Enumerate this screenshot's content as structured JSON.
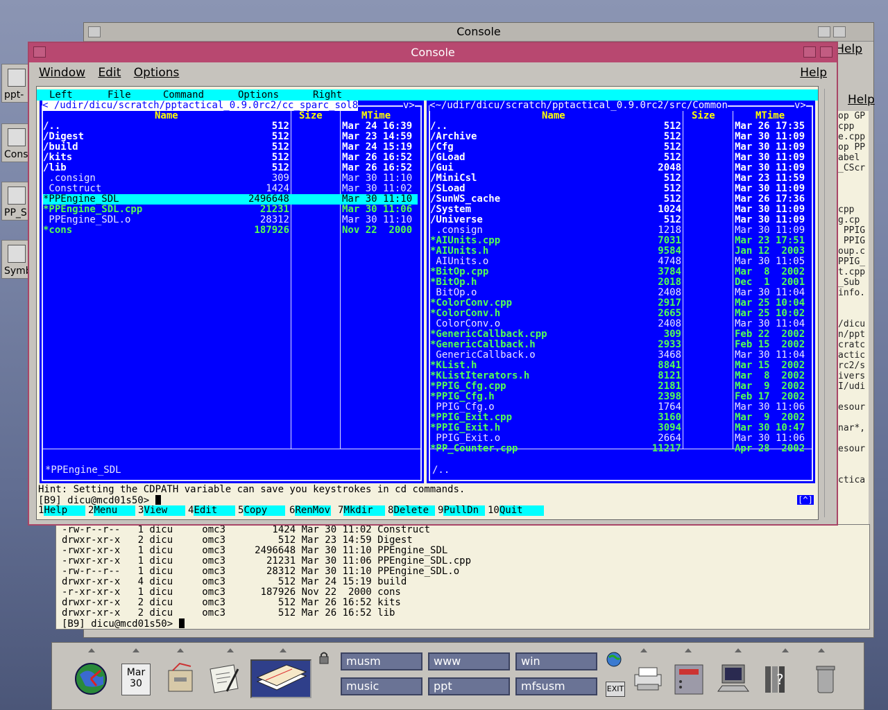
{
  "back_window": {
    "title": "Console",
    "help": "Help",
    "help2": "Help"
  },
  "left_icons": [
    "ppt-",
    "Cons",
    "PP_S",
    "Symb"
  ],
  "right_strip_lines": [
    "op GP",
    "cpp",
    "e.cpp",
    "op PP",
    "abel",
    "_CScr",
    "",
    "",
    "",
    "cpp",
    "g.cp",
    " PPIG",
    " PPIG",
    "oup.c",
    "PPIG_",
    "t.cpp",
    "_Sub",
    "info.",
    "",
    "",
    "/dicu",
    "n/ppt",
    "cratc",
    "actic",
    "rc2/s",
    "ivers",
    "I/udi",
    "",
    "esour",
    "",
    "nar*,",
    "",
    "esour",
    "",
    "",
    "ctica"
  ],
  "bottom_terminal_lines": [
    "-rw-r--r--   1 dicu     omc3        1424 Mar 30 11:02 Construct",
    "drwxr-xr-x   2 dicu     omc3         512 Mar 23 14:59 Digest",
    "-rwxr-xr-x   1 dicu     omc3     2496648 Mar 30 11:10 PPEngine_SDL",
    "-rwxr-xr-x   1 dicu     omc3       21231 Mar 30 11:06 PPEngine_SDL.cpp",
    "-rw-r--r--   1 dicu     omc3       28312 Mar 30 11:10 PPEngine_SDL.o",
    "drwxr-xr-x   4 dicu     omc3         512 Mar 24 15:19 build",
    "-r-xr-xr-x   1 dicu     omc3      187926 Nov 22  2000 cons",
    "drwxr-xr-x   2 dicu     omc3         512 Mar 26 16:52 kits",
    "drwxr-xr-x   2 dicu     omc3         512 Mar 26 16:52 lib"
  ],
  "bottom_prompt": "[B9] dicu@mcd01s50> ",
  "main_window": {
    "title": "Console",
    "menu": {
      "window": "Window",
      "edit": "Edit",
      "options": "Options",
      "help": "Help"
    }
  },
  "mc": {
    "menubar": [
      "Left",
      "File",
      "Command",
      "Options",
      "Right"
    ],
    "left_panel": {
      "path": "/udir/dicu/scratch/pptactical_0.9.0rc2/cc_sparc_sol8",
      "path_prefix": "<",
      "path_suffix": "v>",
      "headers": {
        "name": "Name",
        "size": "Size",
        "mtime": "MTime"
      },
      "rows": [
        {
          "name": "/..",
          "size": "512",
          "mtime": "Mar 24 16:39",
          "kind": "dir"
        },
        {
          "name": "/Digest",
          "size": "512",
          "mtime": "Mar 23 14:59",
          "kind": "dir"
        },
        {
          "name": "/build",
          "size": "512",
          "mtime": "Mar 24 15:19",
          "kind": "dir"
        },
        {
          "name": "/kits",
          "size": "512",
          "mtime": "Mar 26 16:52",
          "kind": "dir"
        },
        {
          "name": "/lib",
          "size": "512",
          "mtime": "Mar 26 16:52",
          "kind": "dir"
        },
        {
          "name": " .consign",
          "size": "309",
          "mtime": "Mar 30 11:10",
          "kind": "plain"
        },
        {
          "name": " Construct",
          "size": "1424",
          "mtime": "Mar 30 11:02",
          "kind": "plain"
        },
        {
          "name": "*PPEngine_SDL",
          "size": "2496648",
          "mtime": "Mar 30 11:10",
          "kind": "sel"
        },
        {
          "name": "*PPEngine_SDL.cpp",
          "size": "21231",
          "mtime": "Mar 30 11:06",
          "kind": "exec"
        },
        {
          "name": " PPEngine_SDL.o",
          "size": "28312",
          "mtime": "Mar 30 11:10",
          "kind": "plain"
        },
        {
          "name": "*cons",
          "size": "187926",
          "mtime": "Nov 22  2000",
          "kind": "exec"
        }
      ],
      "status": "*PPEngine_SDL"
    },
    "right_panel": {
      "path": "~/udir/dicu/scratch/pptactical_0.9.0rc2/src/Common",
      "path_prefix": "<",
      "path_suffix": "v>",
      "headers": {
        "name": "Name",
        "size": "Size",
        "mtime": "MTime"
      },
      "rows": [
        {
          "name": "/..",
          "size": "512",
          "mtime": "Mar 26 17:35",
          "kind": "dir"
        },
        {
          "name": "/Archive",
          "size": "512",
          "mtime": "Mar 30 11:09",
          "kind": "dir"
        },
        {
          "name": "/Cfg",
          "size": "512",
          "mtime": "Mar 30 11:09",
          "kind": "dir"
        },
        {
          "name": "/GLoad",
          "size": "512",
          "mtime": "Mar 30 11:09",
          "kind": "dir"
        },
        {
          "name": "/Gui",
          "size": "2048",
          "mtime": "Mar 30 11:09",
          "kind": "dir"
        },
        {
          "name": "/MiniCsl",
          "size": "512",
          "mtime": "Mar 23 11:59",
          "kind": "dir"
        },
        {
          "name": "/SLoad",
          "size": "512",
          "mtime": "Mar 30 11:09",
          "kind": "dir"
        },
        {
          "name": "/SunWS_cache",
          "size": "512",
          "mtime": "Mar 26 17:36",
          "kind": "dir"
        },
        {
          "name": "/System",
          "size": "1024",
          "mtime": "Mar 30 11:09",
          "kind": "dir"
        },
        {
          "name": "/Universe",
          "size": "512",
          "mtime": "Mar 30 11:09",
          "kind": "dir"
        },
        {
          "name": " .consign",
          "size": "1218",
          "mtime": "Mar 30 11:09",
          "kind": "plain"
        },
        {
          "name": "*AIUnits.cpp",
          "size": "7031",
          "mtime": "Mar 23 17:51",
          "kind": "exec"
        },
        {
          "name": "*AIUnits.h",
          "size": "9584",
          "mtime": "Jan 12  2003",
          "kind": "exec"
        },
        {
          "name": " AIUnits.o",
          "size": "4748",
          "mtime": "Mar 30 11:05",
          "kind": "plain"
        },
        {
          "name": "*BitOp.cpp",
          "size": "3784",
          "mtime": "Mar  8  2002",
          "kind": "exec"
        },
        {
          "name": "*BitOp.h",
          "size": "2018",
          "mtime": "Dec  1  2001",
          "kind": "exec"
        },
        {
          "name": " BitOp.o",
          "size": "2408",
          "mtime": "Mar 30 11:04",
          "kind": "plain"
        },
        {
          "name": "*ColorConv.cpp",
          "size": "2917",
          "mtime": "Mar 25 10:04",
          "kind": "exec"
        },
        {
          "name": "*ColorConv.h",
          "size": "2665",
          "mtime": "Mar 25 10:02",
          "kind": "exec"
        },
        {
          "name": " ColorConv.o",
          "size": "2408",
          "mtime": "Mar 30 11:04",
          "kind": "plain"
        },
        {
          "name": "*GenericCallback.cpp",
          "size": "309",
          "mtime": "Feb 22  2002",
          "kind": "exec"
        },
        {
          "name": "*GenericCallback.h",
          "size": "2933",
          "mtime": "Feb 15  2002",
          "kind": "exec"
        },
        {
          "name": " GenericCallback.o",
          "size": "3468",
          "mtime": "Mar 30 11:04",
          "kind": "plain"
        },
        {
          "name": "*KList.h",
          "size": "8841",
          "mtime": "Mar 15  2002",
          "kind": "exec"
        },
        {
          "name": "*KListIterators.h",
          "size": "8121",
          "mtime": "Mar  8  2002",
          "kind": "exec"
        },
        {
          "name": "*PPIG_Cfg.cpp",
          "size": "2181",
          "mtime": "Mar  9  2002",
          "kind": "exec"
        },
        {
          "name": "*PPIG_Cfg.h",
          "size": "2398",
          "mtime": "Feb 17  2002",
          "kind": "exec"
        },
        {
          "name": " PPIG_Cfg.o",
          "size": "1764",
          "mtime": "Mar 30 11:06",
          "kind": "plain"
        },
        {
          "name": "*PPIG_Exit.cpp",
          "size": "3160",
          "mtime": "Mar  9  2002",
          "kind": "exec"
        },
        {
          "name": "*PPIG_Exit.h",
          "size": "3094",
          "mtime": "Mar 30 10:47",
          "kind": "exec"
        },
        {
          "name": " PPIG_Exit.o",
          "size": "2664",
          "mtime": "Mar 30 11:06",
          "kind": "plain"
        },
        {
          "name": "*PP_Counter.cpp",
          "size": "11217",
          "mtime": "Apr 28  2002",
          "kind": "exec"
        }
      ],
      "status": "/.."
    },
    "hint": "Hint: Setting the CDPATH variable can save you keystrokes in cd commands.",
    "prompt": "[B9] dicu@mcd01s50> ",
    "caret_box": "[^]",
    "fkeys": [
      {
        "n": "1",
        "label": "Help"
      },
      {
        "n": "2",
        "label": "Menu"
      },
      {
        "n": "3",
        "label": "View"
      },
      {
        "n": "4",
        "label": "Edit"
      },
      {
        "n": "5",
        "label": "Copy"
      },
      {
        "n": "6",
        "label": "RenMov"
      },
      {
        "n": "7",
        "label": "Mkdir"
      },
      {
        "n": "8",
        "label": "Delete"
      },
      {
        "n": "9",
        "label": "PullDn"
      },
      {
        "n": "10",
        "label": "Quit"
      }
    ]
  },
  "taskbar": {
    "date_month": "Mar",
    "date_day": "30",
    "workspaces": [
      "musm",
      "www",
      "win",
      "music",
      "ppt",
      "mfsusm"
    ],
    "exit_label": "EXIT"
  }
}
